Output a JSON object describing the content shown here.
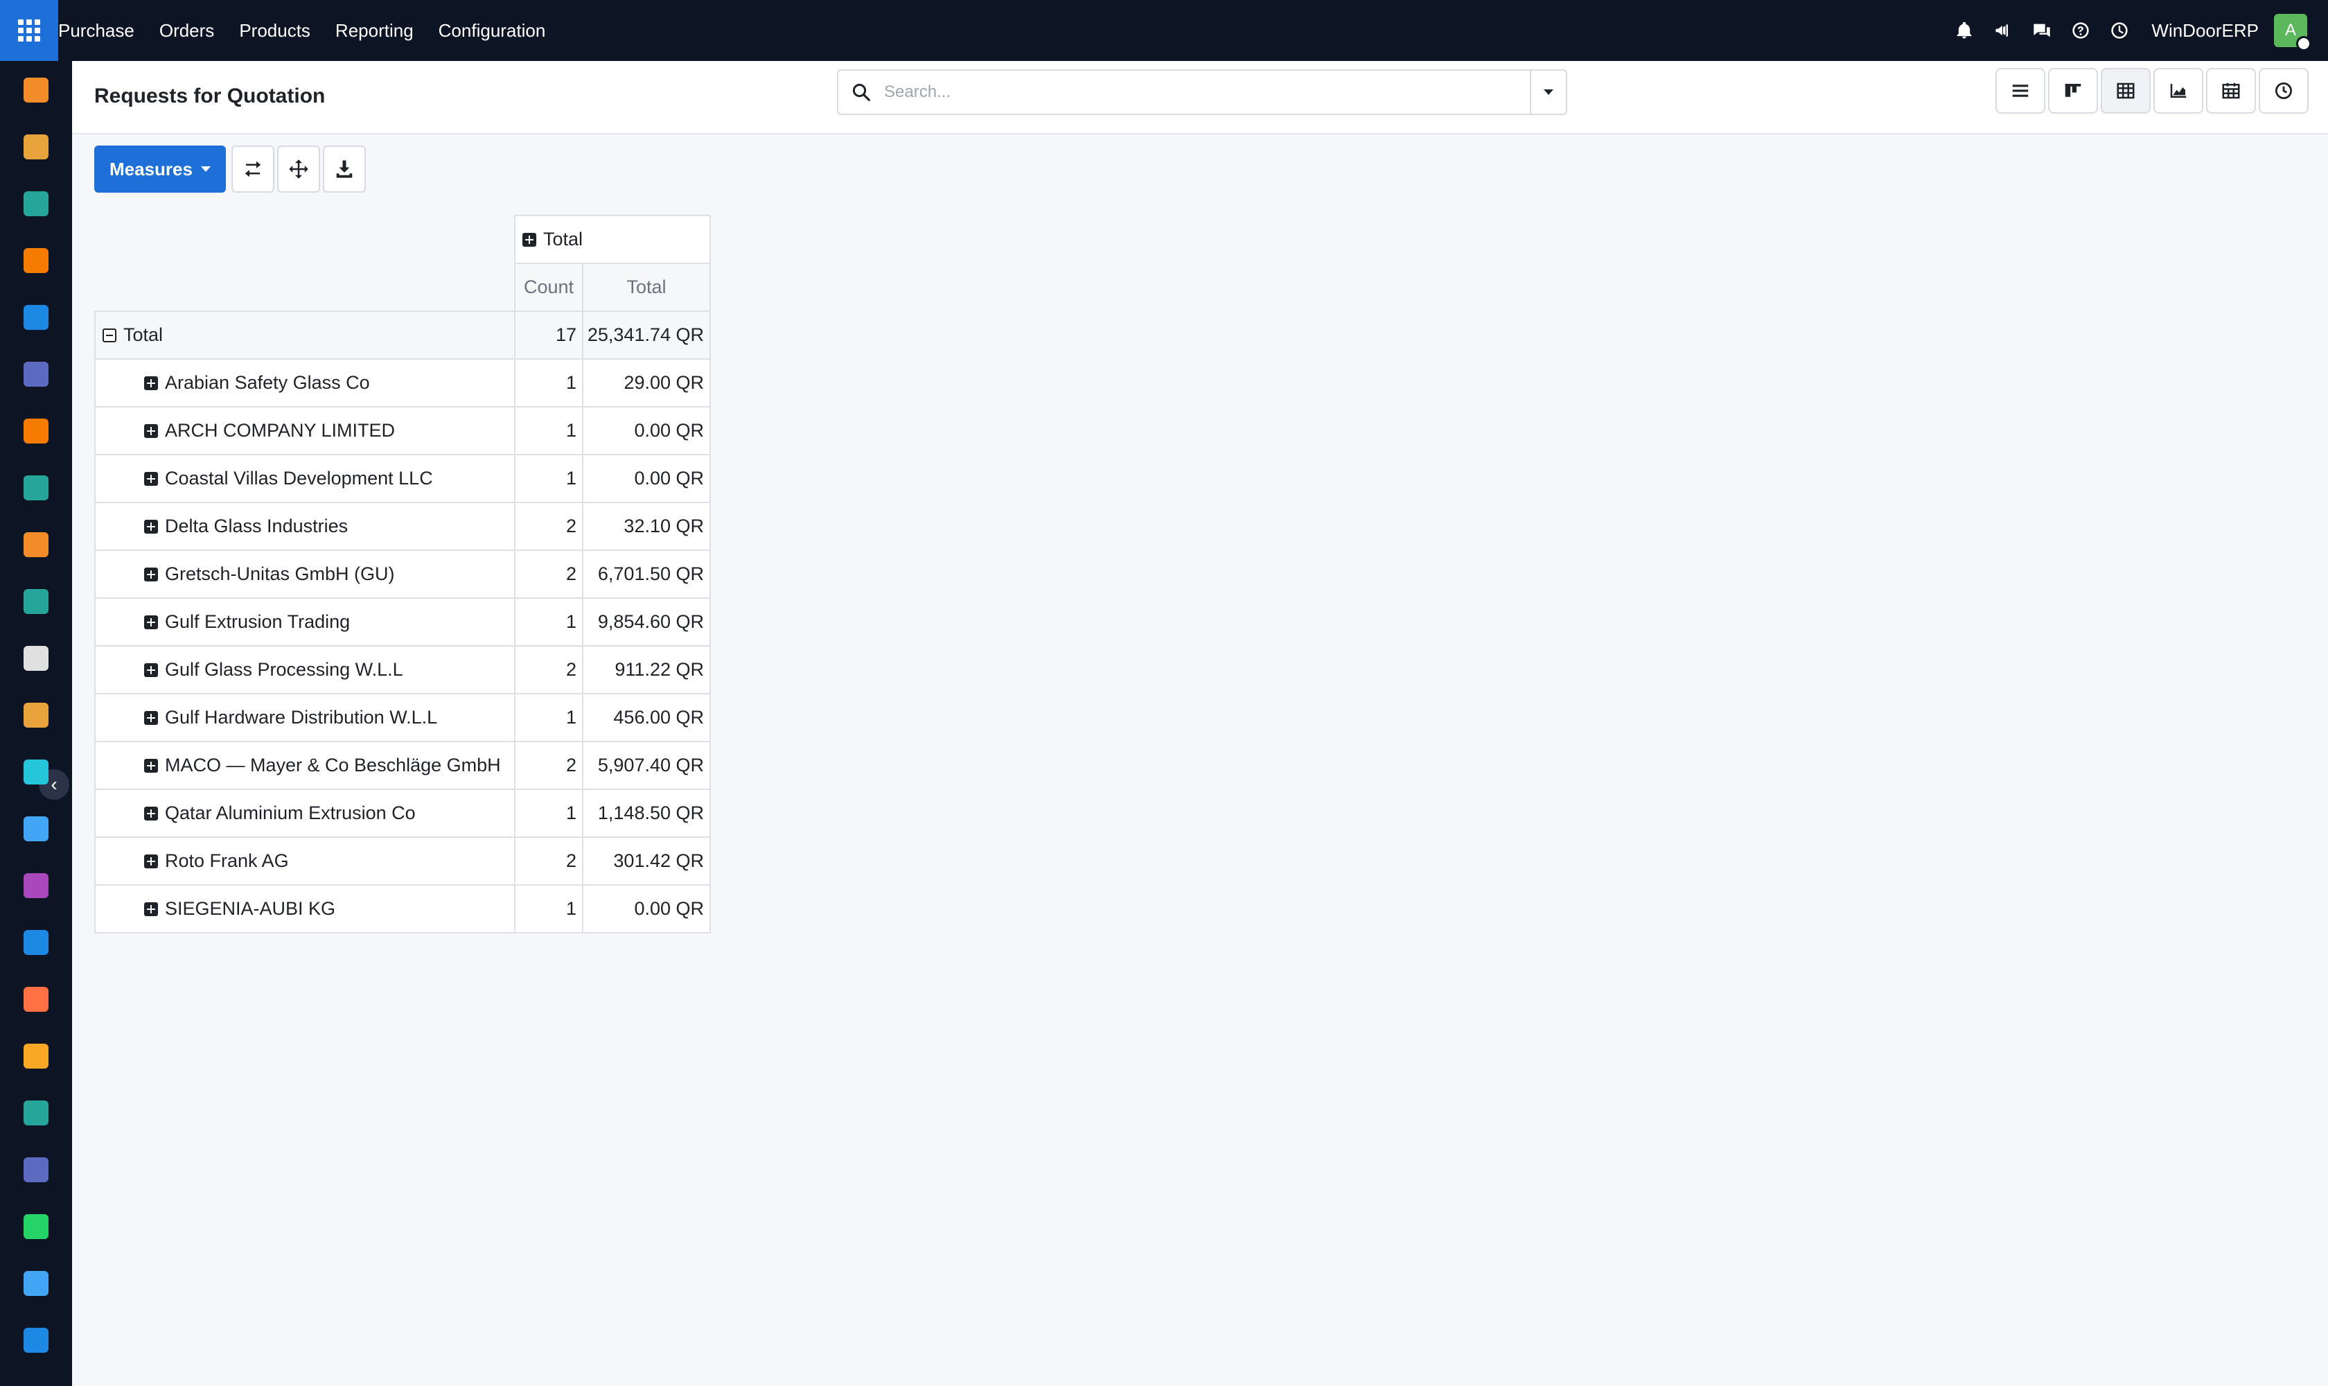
{
  "topbar": {
    "menu": [
      "Purchase",
      "Orders",
      "Products",
      "Reporting",
      "Configuration"
    ],
    "company": "WinDoorERP",
    "avatar_letter": "A",
    "icons": [
      "bell-icon",
      "megaphone-icon",
      "chat-icon",
      "help-icon",
      "clock-icon"
    ]
  },
  "sidebar": {
    "apps": [
      {
        "icon": "bar-chart-app-icon",
        "color": "#f28c28"
      },
      {
        "icon": "palette-app-icon",
        "color": "#e8a33d"
      },
      {
        "icon": "contacts-app-icon",
        "color": "#26a69a"
      },
      {
        "icon": "chat-bubble-app-icon",
        "color": "#f57c00"
      },
      {
        "icon": "wave-app-icon",
        "color": "#1e88e5"
      },
      {
        "icon": "mail-app-icon",
        "color": "#5c6bc0"
      },
      {
        "icon": "bubble-app-icon",
        "color": "#f57c00"
      },
      {
        "icon": "v-shape-app-icon",
        "color": "#26a69a"
      },
      {
        "icon": "bar-chart-app-icon-2",
        "color": "#f28c28"
      },
      {
        "icon": "contacts-app-icon-2",
        "color": "#26a69a"
      },
      {
        "icon": "cube-app-icon",
        "color": "#e0e0e0"
      },
      {
        "icon": "paint-app-icon",
        "color": "#e8a33d"
      },
      {
        "icon": "check-app-icon",
        "color": "#26c6da"
      },
      {
        "icon": "book-app-icon",
        "color": "#42a5f5"
      },
      {
        "icon": "box-app-icon",
        "color": "#ab47bc"
      },
      {
        "icon": "dollar-app-icon",
        "color": "#1e88e5"
      },
      {
        "icon": "team-app-icon",
        "color": "#ff7043"
      },
      {
        "icon": "calendar-31-app-icon",
        "color": "#f9a825"
      },
      {
        "icon": "sign-app-icon",
        "color": "#26a69a"
      },
      {
        "icon": "dashboard-app-icon",
        "color": "#5c6bc0"
      },
      {
        "icon": "whatsapp-app-icon",
        "color": "#25d366"
      },
      {
        "icon": "gauge-app-icon",
        "color": "#42a5f5"
      },
      {
        "icon": "wave-app-icon-2",
        "color": "#1e88e5"
      }
    ]
  },
  "control_panel": {
    "title": "Requests for Quotation",
    "search_placeholder": "Search...",
    "views": [
      "list-view-icon",
      "kanban-view-icon",
      "pivot-view-icon",
      "graph-view-icon",
      "calendar-view-icon",
      "activity-view-icon"
    ]
  },
  "actions": {
    "measures_label": "Measures"
  },
  "pivot": {
    "col_header": "Total",
    "measures": [
      "Count",
      "Total"
    ],
    "total_row": {
      "label": "Total",
      "count": "17",
      "total": "25,341.74 QR"
    },
    "rows": [
      {
        "label": "Arabian Safety Glass Co",
        "count": "1",
        "total": "29.00 QR"
      },
      {
        "label": "ARCH COMPANY LIMITED",
        "count": "1",
        "total": "0.00 QR"
      },
      {
        "label": "Coastal Villas Development LLC",
        "count": "1",
        "total": "0.00 QR"
      },
      {
        "label": "Delta Glass Industries",
        "count": "2",
        "total": "32.10 QR"
      },
      {
        "label": "Gretsch-Unitas GmbH (GU)",
        "count": "2",
        "total": "6,701.50 QR"
      },
      {
        "label": "Gulf Extrusion Trading",
        "count": "1",
        "total": "9,854.60 QR"
      },
      {
        "label": "Gulf Glass Processing W.L.L",
        "count": "2",
        "total": "911.22 QR"
      },
      {
        "label": "Gulf Hardware Distribution W.L.L",
        "count": "1",
        "total": "456.00 QR"
      },
      {
        "label": "MACO — Mayer & Co Beschläge GmbH",
        "count": "2",
        "total": "5,907.40 QR"
      },
      {
        "label": "Qatar Aluminium Extrusion Co",
        "count": "1",
        "total": "1,148.50 QR"
      },
      {
        "label": "Roto Frank AG",
        "count": "2",
        "total": "301.42 QR"
      },
      {
        "label": "SIEGENIA-AUBI KG",
        "count": "1",
        "total": "0.00 QR"
      }
    ]
  }
}
